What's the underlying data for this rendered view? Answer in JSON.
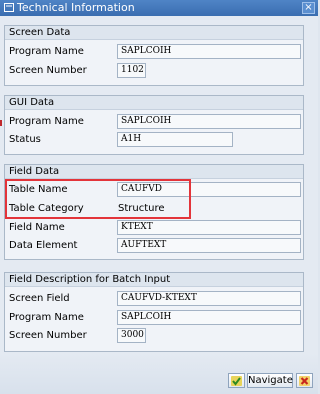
{
  "window": {
    "title": "Technical Information",
    "close_glyph": "×"
  },
  "screen_data": {
    "heading": "Screen Data",
    "program_name_label": "Program Name",
    "program_name": "SAPLCOIH",
    "screen_number_label": "Screen Number",
    "screen_number": "1102"
  },
  "gui_data": {
    "heading": "GUI Data",
    "program_name_label": "Program Name",
    "program_name": "SAPLCOIH",
    "status_label": "Status",
    "status": "A1H"
  },
  "field_data": {
    "heading": "Field Data",
    "table_name_label": "Table Name",
    "table_name": "CAUFVD",
    "table_category_label": "Table Category",
    "table_category": "Structure",
    "field_name_label": "Field Name",
    "field_name": "KTEXT",
    "data_element_label": "Data Element",
    "data_element": "AUFTEXT"
  },
  "batch_input": {
    "heading": "Field Description for Batch Input",
    "screen_field_label": "Screen Field",
    "screen_field": "CAUFVD-KTEXT",
    "program_name_label": "Program Name",
    "program_name": "SAPLCOIH",
    "screen_number_label": "Screen Number",
    "screen_number": "3000"
  },
  "footer": {
    "navigate_label": "Navigate"
  },
  "colors": {
    "highlight": "#e3343a",
    "title_bar": "#3a6db0",
    "confirm": "#3a9a2a",
    "cancel": "#c8281e"
  }
}
